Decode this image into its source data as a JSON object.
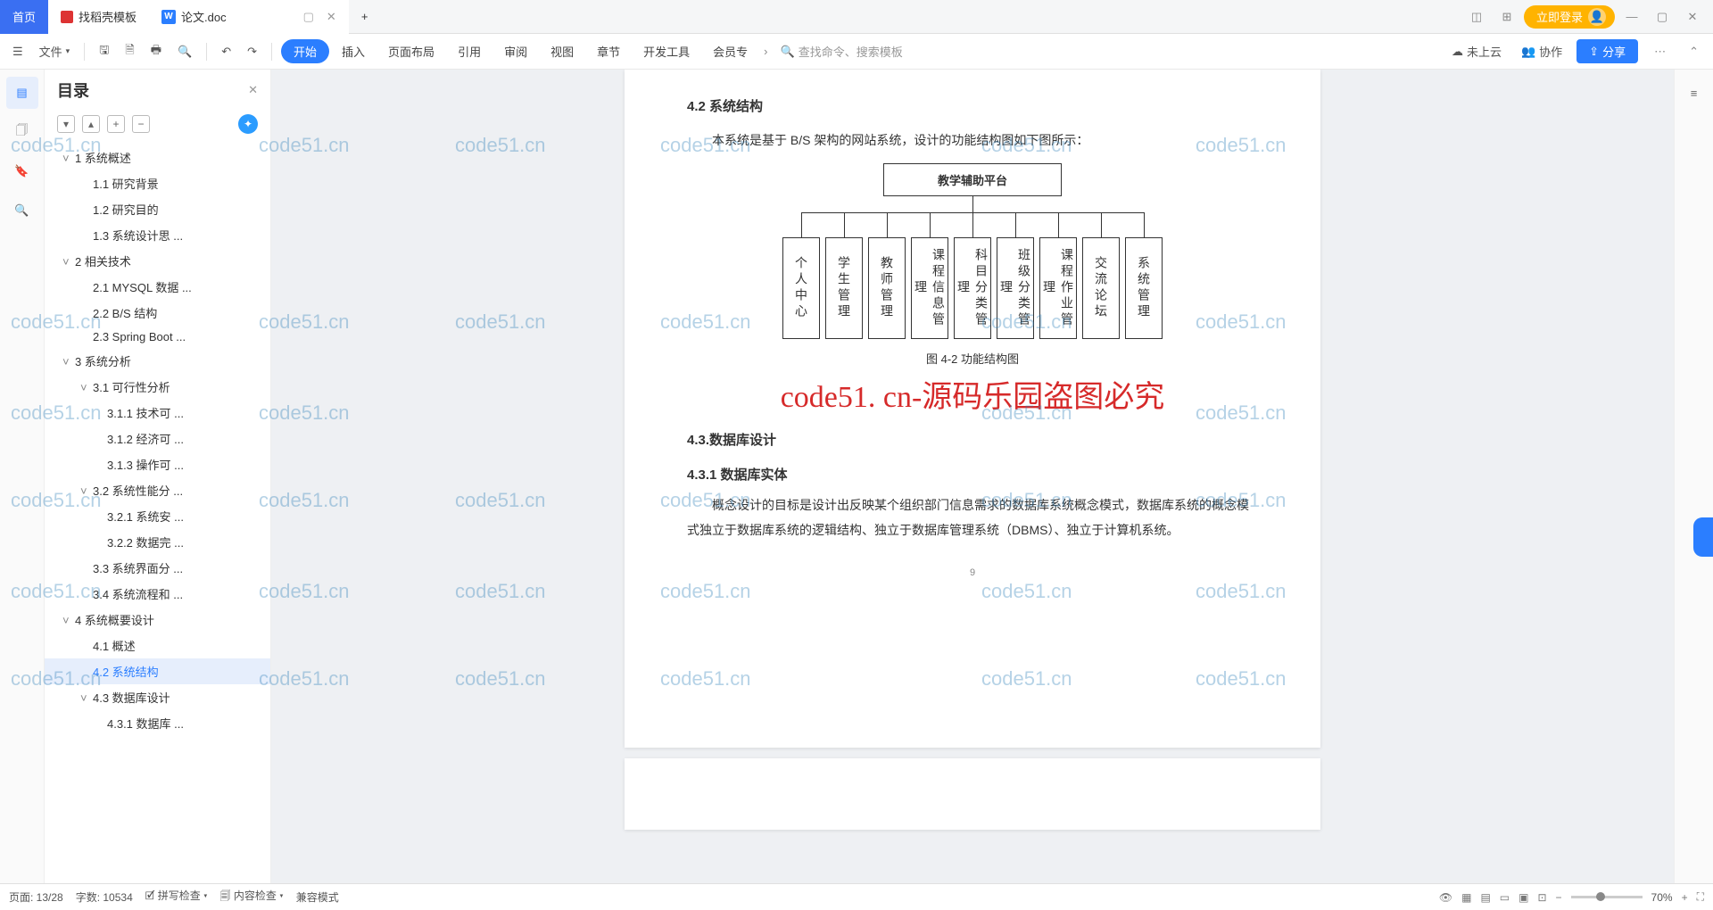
{
  "titlebar": {
    "home": "首页",
    "tab2": "找稻壳模板",
    "tab3": "论文.doc",
    "plus": "+",
    "login": "立即登录"
  },
  "ribbon": {
    "file": "文件",
    "menu": [
      "开始",
      "插入",
      "页面布局",
      "引用",
      "审阅",
      "视图",
      "章节",
      "开发工具",
      "会员专"
    ],
    "search_placeholder": "查找命令、搜索模板",
    "not_uploaded": "未上云",
    "collab": "协作",
    "share": "分享"
  },
  "toc": {
    "title": "目录",
    "items": [
      {
        "lvl": 1,
        "chev": "v",
        "txt": "1 系统概述"
      },
      {
        "lvl": 2,
        "txt": "1.1 研究背景"
      },
      {
        "lvl": 2,
        "txt": "1.2 研究目的"
      },
      {
        "lvl": 2,
        "txt": "1.3 系统设计思 ..."
      },
      {
        "lvl": 1,
        "chev": "v",
        "txt": "2 相关技术"
      },
      {
        "lvl": 2,
        "txt": "2.1 MYSQL 数据 ..."
      },
      {
        "lvl": 2,
        "txt": "2.2 B/S 结构"
      },
      {
        "lvl": 2,
        "txt": "2.3 Spring Boot ..."
      },
      {
        "lvl": 1,
        "chev": "v",
        "txt": "3 系统分析"
      },
      {
        "lvl": 2,
        "chev": "v",
        "txt": "3.1 可行性分析"
      },
      {
        "lvl": 3,
        "txt": "3.1.1 技术可 ..."
      },
      {
        "lvl": 3,
        "txt": "3.1.2 经济可 ..."
      },
      {
        "lvl": 3,
        "txt": "3.1.3 操作可 ..."
      },
      {
        "lvl": 2,
        "chev": "v",
        "txt": "3.2 系统性能分 ..."
      },
      {
        "lvl": 3,
        "txt": "3.2.1 系统安 ..."
      },
      {
        "lvl": 3,
        "txt": "3.2.2 数据完 ..."
      },
      {
        "lvl": 2,
        "txt": "3.3 系统界面分 ..."
      },
      {
        "lvl": 2,
        "txt": "3.4 系统流程和 ..."
      },
      {
        "lvl": 1,
        "chev": "v",
        "txt": "4 系统概要设计"
      },
      {
        "lvl": 2,
        "txt": "4.1 概述"
      },
      {
        "lvl": 2,
        "txt": "4.2 系统结构",
        "selected": true
      },
      {
        "lvl": 2,
        "chev": "v",
        "txt": "4.3 数据库设计"
      },
      {
        "lvl": 3,
        "txt": "4.3.1 数据库 ..."
      }
    ]
  },
  "doc": {
    "h42": "4.2 系统结构",
    "p1": "本系统是基于 B/S 架构的网站系统，设计的功能结构图如下图所示：",
    "dg_top": "教学辅助平台",
    "dg_boxes": [
      "个人中心",
      "学生管理",
      "教师管理",
      "课程信息管理",
      "科目分类管理",
      "班级分类管理",
      "课程作业管理",
      "交流论坛",
      "系统管理"
    ],
    "caption": "图 4-2 功能结构图",
    "red": "code51. cn-源码乐园盗图必究",
    "h43": "4.3.数据库设计",
    "h431": "4.3.1 数据库实体",
    "p2": "概念设计的目标是设计出反映某个组织部门信息需求的数据库系统概念模式，数据库系统的概念模式独立于数据库系统的逻辑结构、独立于数据库管理系统（DBMS）、独立于计算机系统。",
    "pagenum": "9"
  },
  "status": {
    "page": "页面: 13/28",
    "words": "字数: 10534",
    "spell": "拼写检查",
    "content": "内容检查",
    "compat": "兼容模式",
    "zoom": "70%"
  },
  "watermark": "code51.cn"
}
